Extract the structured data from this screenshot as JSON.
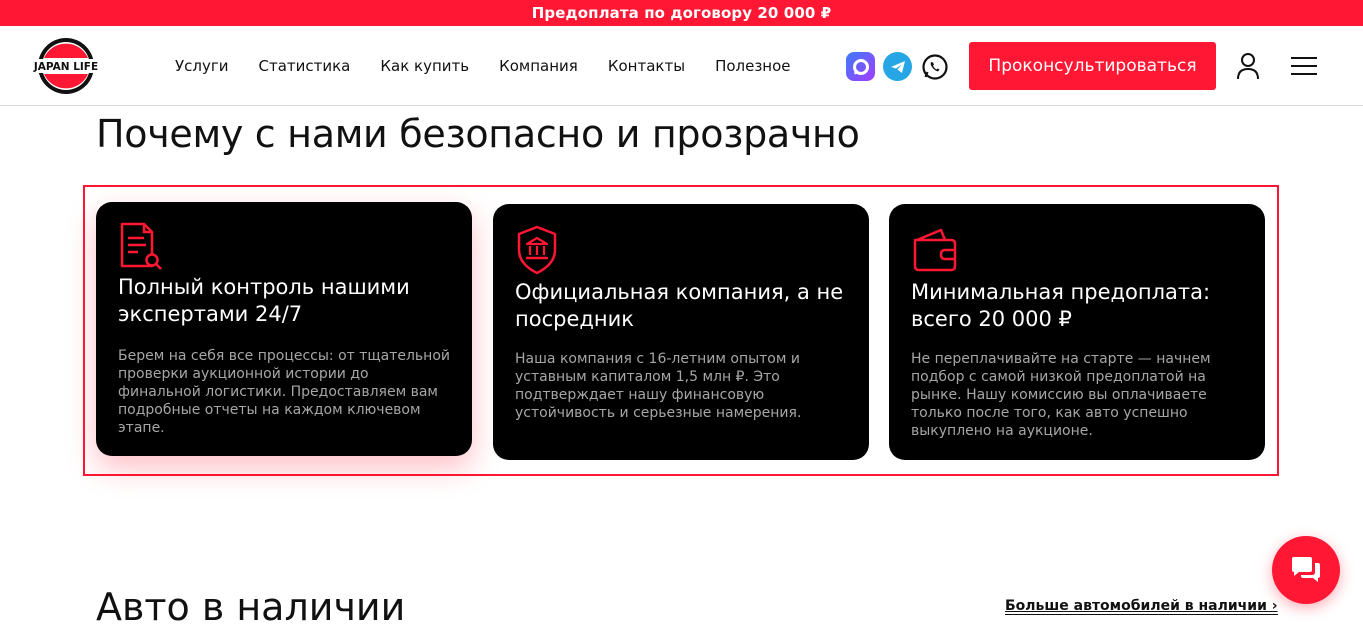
{
  "promo": {
    "text": "Предоплата по договору 20 000 ₽"
  },
  "header": {
    "logo_text": "JAPAN LIFE",
    "nav": [
      "Услуги",
      "Статистика",
      "Как купить",
      "Компания",
      "Контакты",
      "Полезное"
    ],
    "socials": [
      "max-messenger-icon",
      "telegram-icon",
      "whatsapp-icon"
    ],
    "cta_label": "Проконсультироваться"
  },
  "section": {
    "title": "Почему с нами безопасно и прозрачно",
    "cards": [
      {
        "icon": "document-search-icon",
        "title": "Полный контроль нашими экспертами 24/7",
        "text": "Берем на себя все процессы: от тщательной проверки аукционной истории до финальной логистики. Предоставляем вам подробные отчеты на каждом ключевом этапе."
      },
      {
        "icon": "bank-shield-icon",
        "title": "Официальная компания, а не посредник",
        "text": "Наша компания с 16-летним опытом и уставным капиталом 1,5 млн ₽. Это подтверждает нашу финансовую устойчивость и серьезные намерения."
      },
      {
        "icon": "wallet-icon",
        "title": "Минимальная предоплата: всего 20 000 ₽",
        "text": "Не переплачивайте на старте — начнем подбор с самой низкой предоплатой на рынке. Нашу комиссию вы оплачиваете только после того, как авто успешно выкуплено на аукционе."
      }
    ]
  },
  "cars": {
    "title": "Авто в наличии",
    "more_link": "Больше автомобилей в наличии ›"
  },
  "colors": {
    "accent": "#ff1733",
    "card_bg": "#000000",
    "card_text": "#a6a6a6"
  }
}
